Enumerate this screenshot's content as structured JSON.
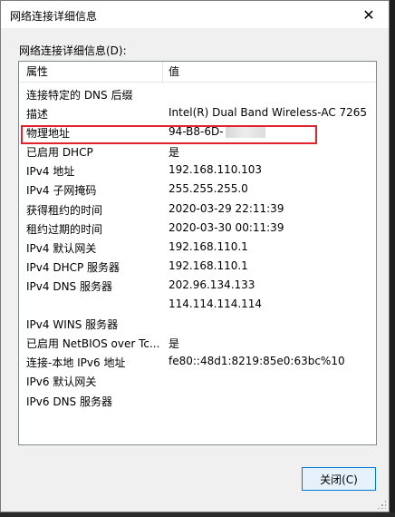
{
  "window": {
    "title": "网络连接详细信息",
    "close_glyph": "✕"
  },
  "group_label": "网络连接详细信息(D):",
  "table": {
    "columns": [
      "属性",
      "值"
    ],
    "rows": [
      {
        "name": "连接特定的 DNS 后缀",
        "value": ""
      },
      {
        "name": "描述",
        "value": "Intel(R) Dual Band Wireless-AC 7265"
      },
      {
        "name": "物理地址",
        "value": "94-B8-6D-"
      },
      {
        "name": "已启用 DHCP",
        "value": "是"
      },
      {
        "name": "IPv4 地址",
        "value": "192.168.110.103"
      },
      {
        "name": "IPv4 子网掩码",
        "value": "255.255.255.0"
      },
      {
        "name": "获得租约的时间",
        "value": "2020-03-29 22:11:39"
      },
      {
        "name": "租约过期的时间",
        "value": "2020-03-30 00:11:39"
      },
      {
        "name": "IPv4 默认网关",
        "value": "192.168.110.1"
      },
      {
        "name": "IPv4 DHCP 服务器",
        "value": "192.168.110.1"
      },
      {
        "name": "IPv4 DNS 服务器",
        "value": "202.96.134.133"
      },
      {
        "name": "",
        "value": "114.114.114.114"
      },
      {
        "name": "IPv4 WINS 服务器",
        "value": ""
      },
      {
        "name": "已启用 NetBIOS over Tc...",
        "value": "是"
      },
      {
        "name": "连接-本地 IPv6 地址",
        "value": "fe80::48d1:8219:85e0:63bc%10"
      },
      {
        "name": "IPv6 默认网关",
        "value": ""
      },
      {
        "name": "IPv6 DNS 服务器",
        "value": ""
      }
    ]
  },
  "buttons": {
    "close_label": "关闭(C)"
  },
  "colors": {
    "highlight": "#e0232d",
    "focus": "#0078d7"
  }
}
